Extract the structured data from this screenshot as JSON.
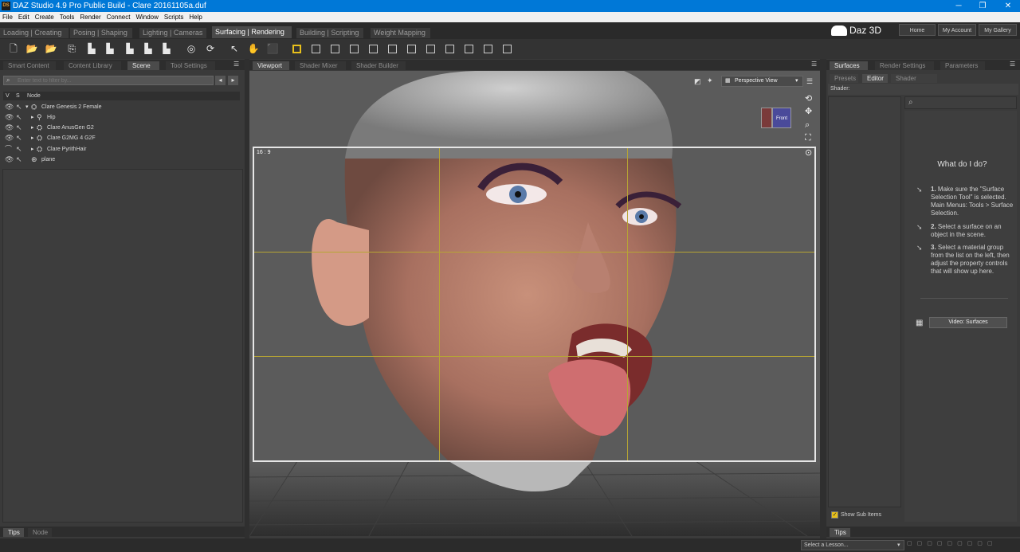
{
  "titlebar": {
    "icon_text": "DS",
    "title": "DAZ Studio 4.9 Pro Public Build - Clare 20161105a.duf",
    "minimize": "─",
    "restore": "❐",
    "close": "✕"
  },
  "menu": [
    "File",
    "Edit",
    "Create",
    "Tools",
    "Render",
    "Connect",
    "Window",
    "Scripts",
    "Help"
  ],
  "activity_tabs": [
    "Loading | Creating",
    "Posing | Shaping",
    "Lighting | Cameras",
    "Surfacing | Rendering",
    "Building | Scripting",
    "Weight Mapping"
  ],
  "active_activity": "Surfacing | Rendering",
  "brand": {
    "logo_text": "Daz 3D"
  },
  "top_buttons": [
    "Home",
    "My Account",
    "My Gallery"
  ],
  "left_panel": {
    "tabs": [
      "Smart Content",
      "Content Library",
      "Scene",
      "Tool Settings"
    ],
    "active_tab": "Scene",
    "filter_placeholder": "Enter text to filter by...",
    "columns": [
      "V",
      "S",
      "Node"
    ],
    "nodes": [
      {
        "label": "Clare Genesis 2 Female",
        "indent": 0,
        "expanded": true,
        "icon": "figure-icon"
      },
      {
        "label": "Hip",
        "indent": 1,
        "expanded": false,
        "icon": "bone-icon"
      },
      {
        "label": "Clare AnusGen G2",
        "indent": 1,
        "expanded": false,
        "icon": "figure-icon"
      },
      {
        "label": "Clare G2MG 4 G2F",
        "indent": 1,
        "expanded": false,
        "icon": "figure-icon"
      },
      {
        "label": "Clare PyrithHair",
        "indent": 1,
        "expanded": false,
        "icon": "figure-icon"
      },
      {
        "label": "plane",
        "indent": 0,
        "expanded": false,
        "icon": "primitive-icon"
      }
    ],
    "bottom_tabs": [
      "Tips",
      "Node"
    ]
  },
  "center": {
    "tabs": [
      "Viewport",
      "Shader Mixer",
      "Shader Builder"
    ],
    "active_tab": "Viewport",
    "view_dropdown": "Perspective View",
    "aspect_label": "16 : 9",
    "cube_label": "Front"
  },
  "right_panel": {
    "tabs": [
      "Surfaces",
      "Render Settings",
      "Parameters"
    ],
    "active_tab": "Surfaces",
    "subtabs": [
      "Presets",
      "Editor",
      "Shader Baker"
    ],
    "active_subtab": "Editor",
    "shader_label": "Shader:",
    "help_title": "What do I do?",
    "steps": [
      {
        "num": "1.",
        "text_bold": "",
        "text": "Make sure the \"Surface Selection Tool\" is selected. Main Menus: Tools > Surface Selection."
      },
      {
        "num": "2.",
        "text": "Select a surface on an object in the scene."
      },
      {
        "num": "3.",
        "text": "Select a material group from the list on the left, then adjust the property controls that will show up here."
      }
    ],
    "video_button": "Video: Surfaces",
    "show_sub_items": "Show Sub Items",
    "show_sub_items_checked": true,
    "bottom_tabs": [
      "Tips"
    ]
  },
  "statusbar": {
    "lesson_placeholder": "Select a Lesson..."
  },
  "colors": {
    "accent_blue": "#0078d7",
    "frame_yellow": "#e8c01c",
    "guide_olive": "#b7a534"
  }
}
